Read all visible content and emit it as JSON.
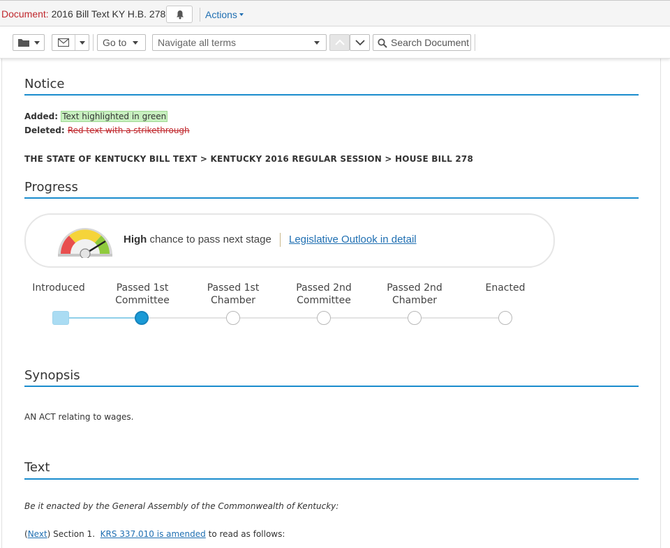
{
  "header": {
    "document_label": "Document:",
    "document_title": "2016 Bill Text KY H.B. 278",
    "actions_label": "Actions"
  },
  "toolbar": {
    "goto_label": "Go to",
    "navigate_placeholder": "Navigate all terms",
    "search_label": "Search Document"
  },
  "notice": {
    "title": "Notice",
    "added_label": "Added:",
    "added_text": "Text highlighted in green",
    "deleted_label": "Deleted:",
    "deleted_text": "Red text with a strikethrough"
  },
  "breadcrumb": "THE STATE OF KENTUCKY BILL TEXT > KENTUCKY 2016 REGULAR SESSION > HOUSE BILL 278",
  "progress": {
    "title": "Progress",
    "chance_level": "High",
    "chance_text": "chance to pass next stage",
    "outlook_link": "Legislative Outlook in detail",
    "stages": [
      {
        "line1": "Introduced",
        "line2": ""
      },
      {
        "line1": "Passed 1st",
        "line2": "Committee"
      },
      {
        "line1": "Passed 1st",
        "line2": "Chamber"
      },
      {
        "line1": "Passed 2nd",
        "line2": "Committee"
      },
      {
        "line1": "Passed 2nd",
        "line2": "Chamber"
      },
      {
        "line1": "Enacted",
        "line2": ""
      }
    ],
    "current_stage_index": 1
  },
  "synopsis": {
    "title": "Synopsis",
    "text": "AN ACT relating to wages."
  },
  "text_section": {
    "title": "Text",
    "enacting_clause": "Be it enacted by the General Assembly of the Commonwealth of Kentucky:",
    "next_link": "Next",
    "section_label": "Section 1.",
    "krs_link": "KRS 337.010 is amended",
    "trailing": "to read as follows:"
  },
  "colors": {
    "accent_blue": "#1a8ccd",
    "link_blue": "#1f6fb2",
    "label_red": "#c0282d",
    "added_green": "#c8f0c0"
  }
}
